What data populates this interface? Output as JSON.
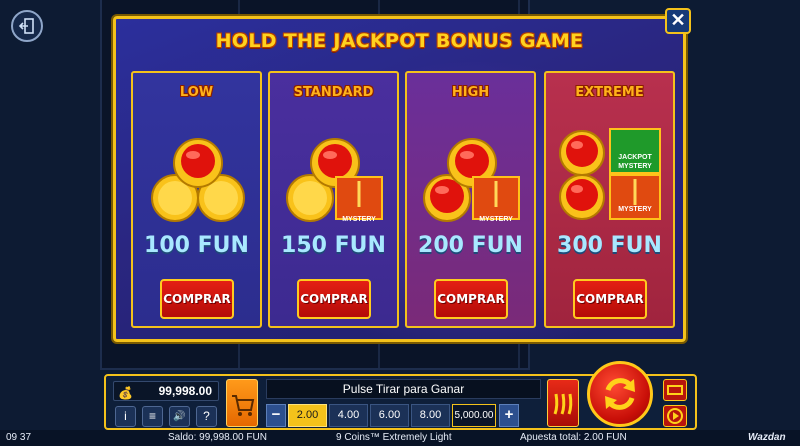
{
  "modal": {
    "title": "HOLD THE JACKPOT BONUS GAME",
    "close_label": "✕",
    "cards": [
      {
        "label": "LOW",
        "price": "100 FUN",
        "button": "COMPRAR"
      },
      {
        "label": "STANDARD",
        "price": "150 FUN",
        "button": "COMPRAR",
        "tile": "MYSTERY"
      },
      {
        "label": "HIGH",
        "price": "200 FUN",
        "button": "COMPRAR",
        "tile": "MYSTERY"
      },
      {
        "label": "EXTREME",
        "price": "300 FUN",
        "button": "COMPRAR",
        "tile_top": "JACKPOT MYSTERY",
        "tile_bottom": "MYSTERY"
      }
    ]
  },
  "controls": {
    "balance_value": "99,998.00",
    "message": "Pulse Tirar para Ganar",
    "bet_minus": "−",
    "bet_plus": "+",
    "bets": [
      "2.00",
      "4.00",
      "6.00",
      "8.00",
      "5,000.00"
    ],
    "selected_bet": "2.00",
    "info_label": "i",
    "menu_label": "≡",
    "sound_label": "🔊",
    "help_label": "?"
  },
  "status": {
    "time": "09 37",
    "saldo": "Saldo: 99,998.00 FUN",
    "game_name": "9 Coins™ Extremely Light",
    "apuesta": "Apuesta total: 2.00 FUN",
    "brand": "Wazdan"
  },
  "colors": {
    "accent_gold": "#f4c21b",
    "button_red": "#e41e14",
    "price_blue": "#a9e8ff",
    "modal_blue": "#2b2f9c"
  }
}
